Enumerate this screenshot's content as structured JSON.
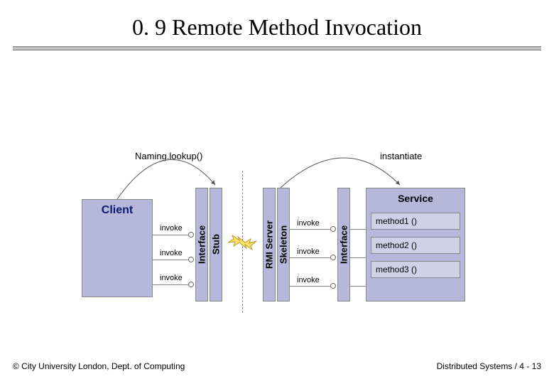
{
  "title": "0. 9 Remote Method Invocation",
  "client_label": "Client",
  "service_label": "Service",
  "iface_label": "Interface",
  "stub_label": "Stub",
  "rmi_server_label": "RMI Server",
  "skeleton_label": "Skeleton",
  "naming_lookup": "Naming.lookup()",
  "instantiate": "instantiate",
  "invoke_left": [
    "invoke",
    "invoke",
    "invoke"
  ],
  "invoke_right": [
    "invoke",
    "invoke",
    "invoke"
  ],
  "methods": [
    "method1 ()",
    "method2 ()",
    "method3 ()"
  ],
  "footer_left": "© City University London, Dept. of Computing",
  "footer_right": "Distributed Systems / 4 - 13"
}
